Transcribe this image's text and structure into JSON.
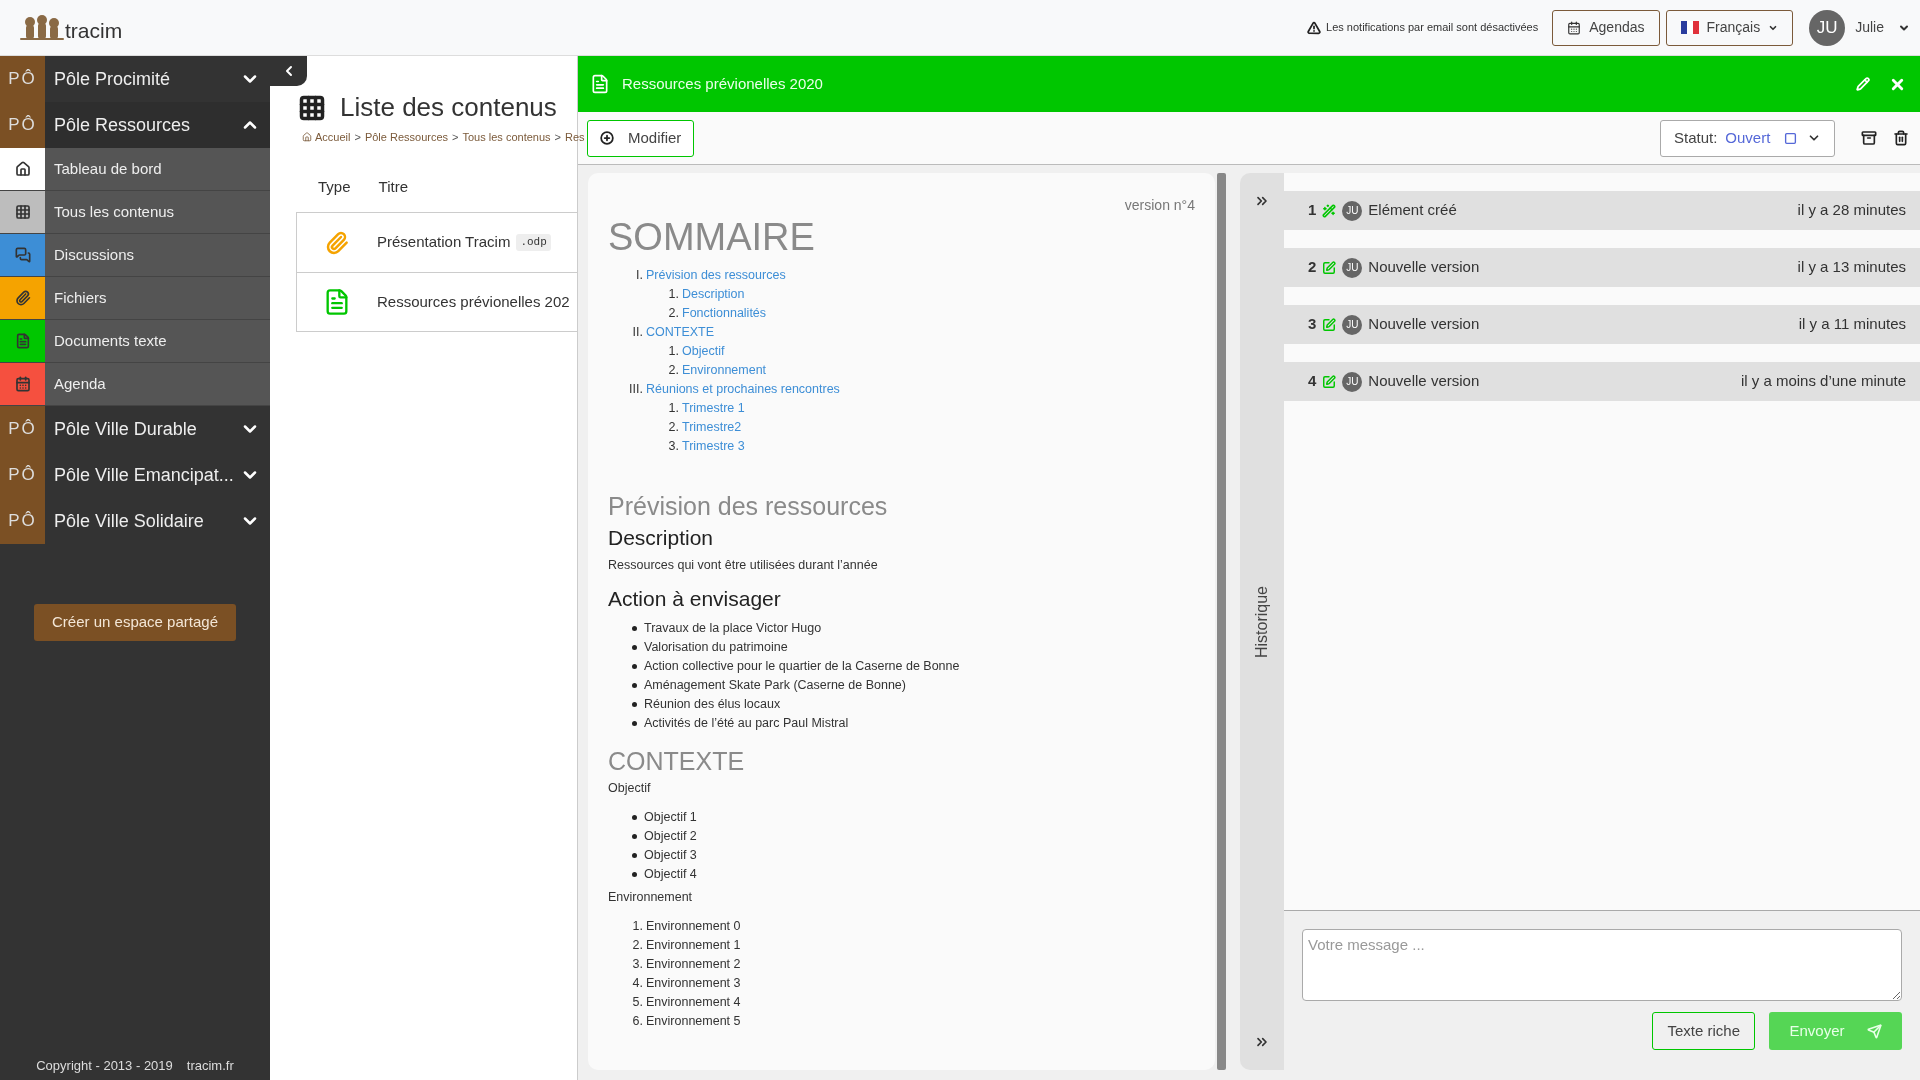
{
  "header": {
    "logo_text": "tracim",
    "notice": "Les notifications par email sont désactivées",
    "agendas_button": "Agendas",
    "language_button": "Français",
    "user": {
      "initials": "JU",
      "name": "Julie"
    }
  },
  "sidebar": {
    "spaces": [
      {
        "badge": "PÔ",
        "name": "Pôle Procimité",
        "expanded": false
      },
      {
        "badge": "PÔ",
        "name": "Pôle Ressources",
        "expanded": true,
        "children": [
          {
            "kind": "dashboard",
            "label": "Tableau de bord"
          },
          {
            "kind": "contents",
            "label": "Tous les contenus"
          },
          {
            "kind": "discussions",
            "label": "Discussions"
          },
          {
            "kind": "files",
            "label": "Fichiers"
          },
          {
            "kind": "documents",
            "label": "Documents texte"
          },
          {
            "kind": "agenda",
            "label": "Agenda"
          }
        ]
      },
      {
        "badge": "PÔ",
        "name": "Pôle Ville Durable",
        "expanded": false
      },
      {
        "badge": "PÔ",
        "name": "Pôle Ville Emancipat...",
        "expanded": false
      },
      {
        "badge": "PÔ",
        "name": "Pôle Ville Solidaire",
        "expanded": false
      }
    ],
    "create_button": "Créer un espace partagé",
    "copyright": "Copyright - 2013 - 2019",
    "site_link": "tracim.fr"
  },
  "content_list": {
    "title": "Liste des contenus",
    "breadcrumb": [
      {
        "kind": "home",
        "label": "Accueil"
      },
      {
        "kind": "separator",
        "label": ">"
      },
      {
        "kind": "link",
        "label": "Pôle Ressources"
      },
      {
        "kind": "separator",
        "label": ">"
      },
      {
        "kind": "link",
        "label": "Tous les contenus"
      },
      {
        "kind": "separator",
        "label": ">"
      },
      {
        "kind": "link",
        "label": "Res"
      }
    ],
    "columns": [
      "Type",
      "Titre"
    ],
    "rows": [
      {
        "kind": "file",
        "title": "Présentation Tracim",
        "extension": ".odp"
      },
      {
        "kind": "document",
        "title": "Ressources prévionelles 202"
      }
    ]
  },
  "panel": {
    "title": "Ressources prévionelles 2020",
    "modify_button": "Modifier",
    "status": {
      "label": "Statut:",
      "value": "Ouvert"
    },
    "version": "version n°4",
    "document": [
      {
        "kind": "title",
        "text": "SOMMAIRE"
      },
      {
        "kind": "toc",
        "items": [
          {
            "number": "I.",
            "label": "Prévision des ressources",
            "children": [
              {
                "number": "1.",
                "label": "Description"
              },
              {
                "number": "2.",
                "label": "Fonctionnalités"
              }
            ]
          },
          {
            "number": "II.",
            "label": "CONTEXTE",
            "children": [
              {
                "number": "1.",
                "label": "Objectif"
              },
              {
                "number": "2.",
                "label": "Environnement"
              }
            ]
          },
          {
            "number": "III.",
            "label": "Réunions et prochaines rencontres",
            "children": [
              {
                "number": "1.",
                "label": "Trimestre 1"
              },
              {
                "number": "2.",
                "label": "Trimestre2"
              },
              {
                "number": "3.",
                "label": "Trimestre 3"
              }
            ]
          }
        ]
      },
      {
        "kind": "section",
        "text": "Prévision des ressources"
      },
      {
        "kind": "subsection",
        "text": "Description"
      },
      {
        "kind": "paragraph",
        "text": "Ressources qui vont être utilisées durant l’année"
      },
      {
        "kind": "subsection",
        "text": "Action à envisager"
      },
      {
        "kind": "bullets",
        "items": [
          "Travaux de la place Victor Hugo",
          "Valorisation du patrimoine",
          "Action collective pour le quartier de la Caserne de Bonne",
          "Aménagement Skate Park (Caserne de Bonne)",
          "Réunion des élus locaux",
          "Activités de l’été au parc Paul Mistral"
        ]
      },
      {
        "kind": "section",
        "text": "CONTEXTE"
      },
      {
        "kind": "paragraph",
        "text": "Objectif"
      },
      {
        "kind": "bullets",
        "items": [
          "Objectif 1",
          "Objectif 2",
          "Objectif 3",
          "Objectif 4"
        ]
      },
      {
        "kind": "paragraph",
        "text": "Environnement"
      },
      {
        "kind": "numbered",
        "items": [
          {
            "number": "1.",
            "label": "Environnement 0"
          },
          {
            "number": "2.",
            "label": "Environnement 1"
          },
          {
            "number": "3.",
            "label": "Environnement 2"
          },
          {
            "number": "4.",
            "label": "Environnement 3"
          },
          {
            "number": "5.",
            "label": "Environnement 4"
          },
          {
            "number": "6.",
            "label": "Environnement 5"
          }
        ]
      }
    ],
    "history": {
      "title": "Historique",
      "items": [
        {
          "number": "1",
          "kind": "created",
          "author": "JU",
          "label": "Elément créé",
          "time": "il y a 28 minutes"
        },
        {
          "number": "2",
          "kind": "version",
          "author": "JU",
          "label": "Nouvelle version",
          "time": "il y a 13 minutes"
        },
        {
          "number": "3",
          "kind": "version",
          "author": "JU",
          "label": "Nouvelle version",
          "time": "il y a 11 minutes"
        },
        {
          "number": "4",
          "kind": "version",
          "author": "JU",
          "label": "Nouvelle version",
          "time": "il y a moins d’une minute"
        }
      ],
      "message": {
        "placeholder": "Votre message ..."
      },
      "rich_text_button": "Texte riche",
      "send_button": "Envoyer"
    }
  }
}
